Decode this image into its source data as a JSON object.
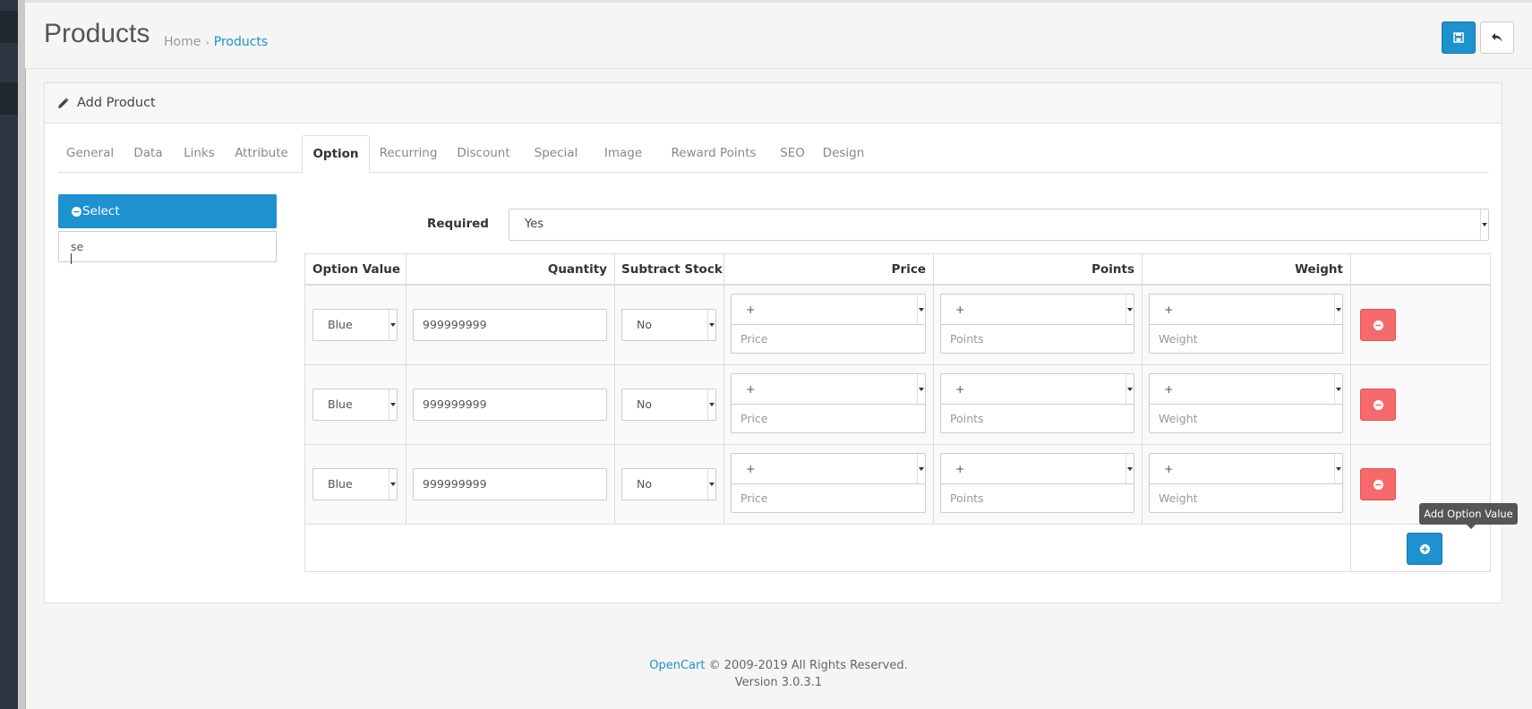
{
  "page": {
    "title": "Products",
    "breadcrumb": {
      "home": "Home",
      "separator": "›",
      "current": "Products"
    }
  },
  "header_actions": {
    "save_icon": "floppy-disk-icon",
    "back_icon": "reply-icon"
  },
  "panel": {
    "title": "Add Product",
    "icon": "pencil-icon"
  },
  "tabs": [
    "General",
    "Data",
    "Links",
    "Attribute",
    "Option",
    "Recurring",
    "Discount",
    "Special",
    "Image",
    "Reward Points",
    "SEO",
    "Design"
  ],
  "active_tab": "Option",
  "option_list": {
    "selected_option": "Select",
    "autocomplete_value": "se"
  },
  "option_form": {
    "required_label": "Required",
    "required_value": "Yes",
    "columns": [
      "Option Value",
      "Quantity",
      "Subtract Stock",
      "Price",
      "Points",
      "Weight"
    ],
    "rows": [
      {
        "option_value": "Blue",
        "quantity": "999999999",
        "subtract": "No",
        "price_prefix": "+",
        "price_placeholder": "Price",
        "points_prefix": "+",
        "points_placeholder": "Points",
        "weight_prefix": "+",
        "weight_placeholder": "Weight"
      },
      {
        "option_value": "Blue",
        "quantity": "999999999",
        "subtract": "No",
        "price_prefix": "+",
        "price_placeholder": "Price",
        "points_prefix": "+",
        "points_placeholder": "Points",
        "weight_prefix": "+",
        "weight_placeholder": "Weight"
      },
      {
        "option_value": "Blue",
        "quantity": "999999999",
        "subtract": "No",
        "price_prefix": "+",
        "price_placeholder": "Price",
        "points_prefix": "+",
        "points_placeholder": "Points",
        "weight_prefix": "+",
        "weight_placeholder": "Weight"
      }
    ],
    "add_tooltip": "Add Option Value"
  },
  "footer": {
    "brand": "OpenCart",
    "copyright": "© 2009-2019 All Rights Reserved.",
    "version": "Version 3.0.3.1"
  },
  "colors": {
    "primary": "#1e91cf",
    "danger": "#f56b6b",
    "sidebar": "#2c3640"
  }
}
